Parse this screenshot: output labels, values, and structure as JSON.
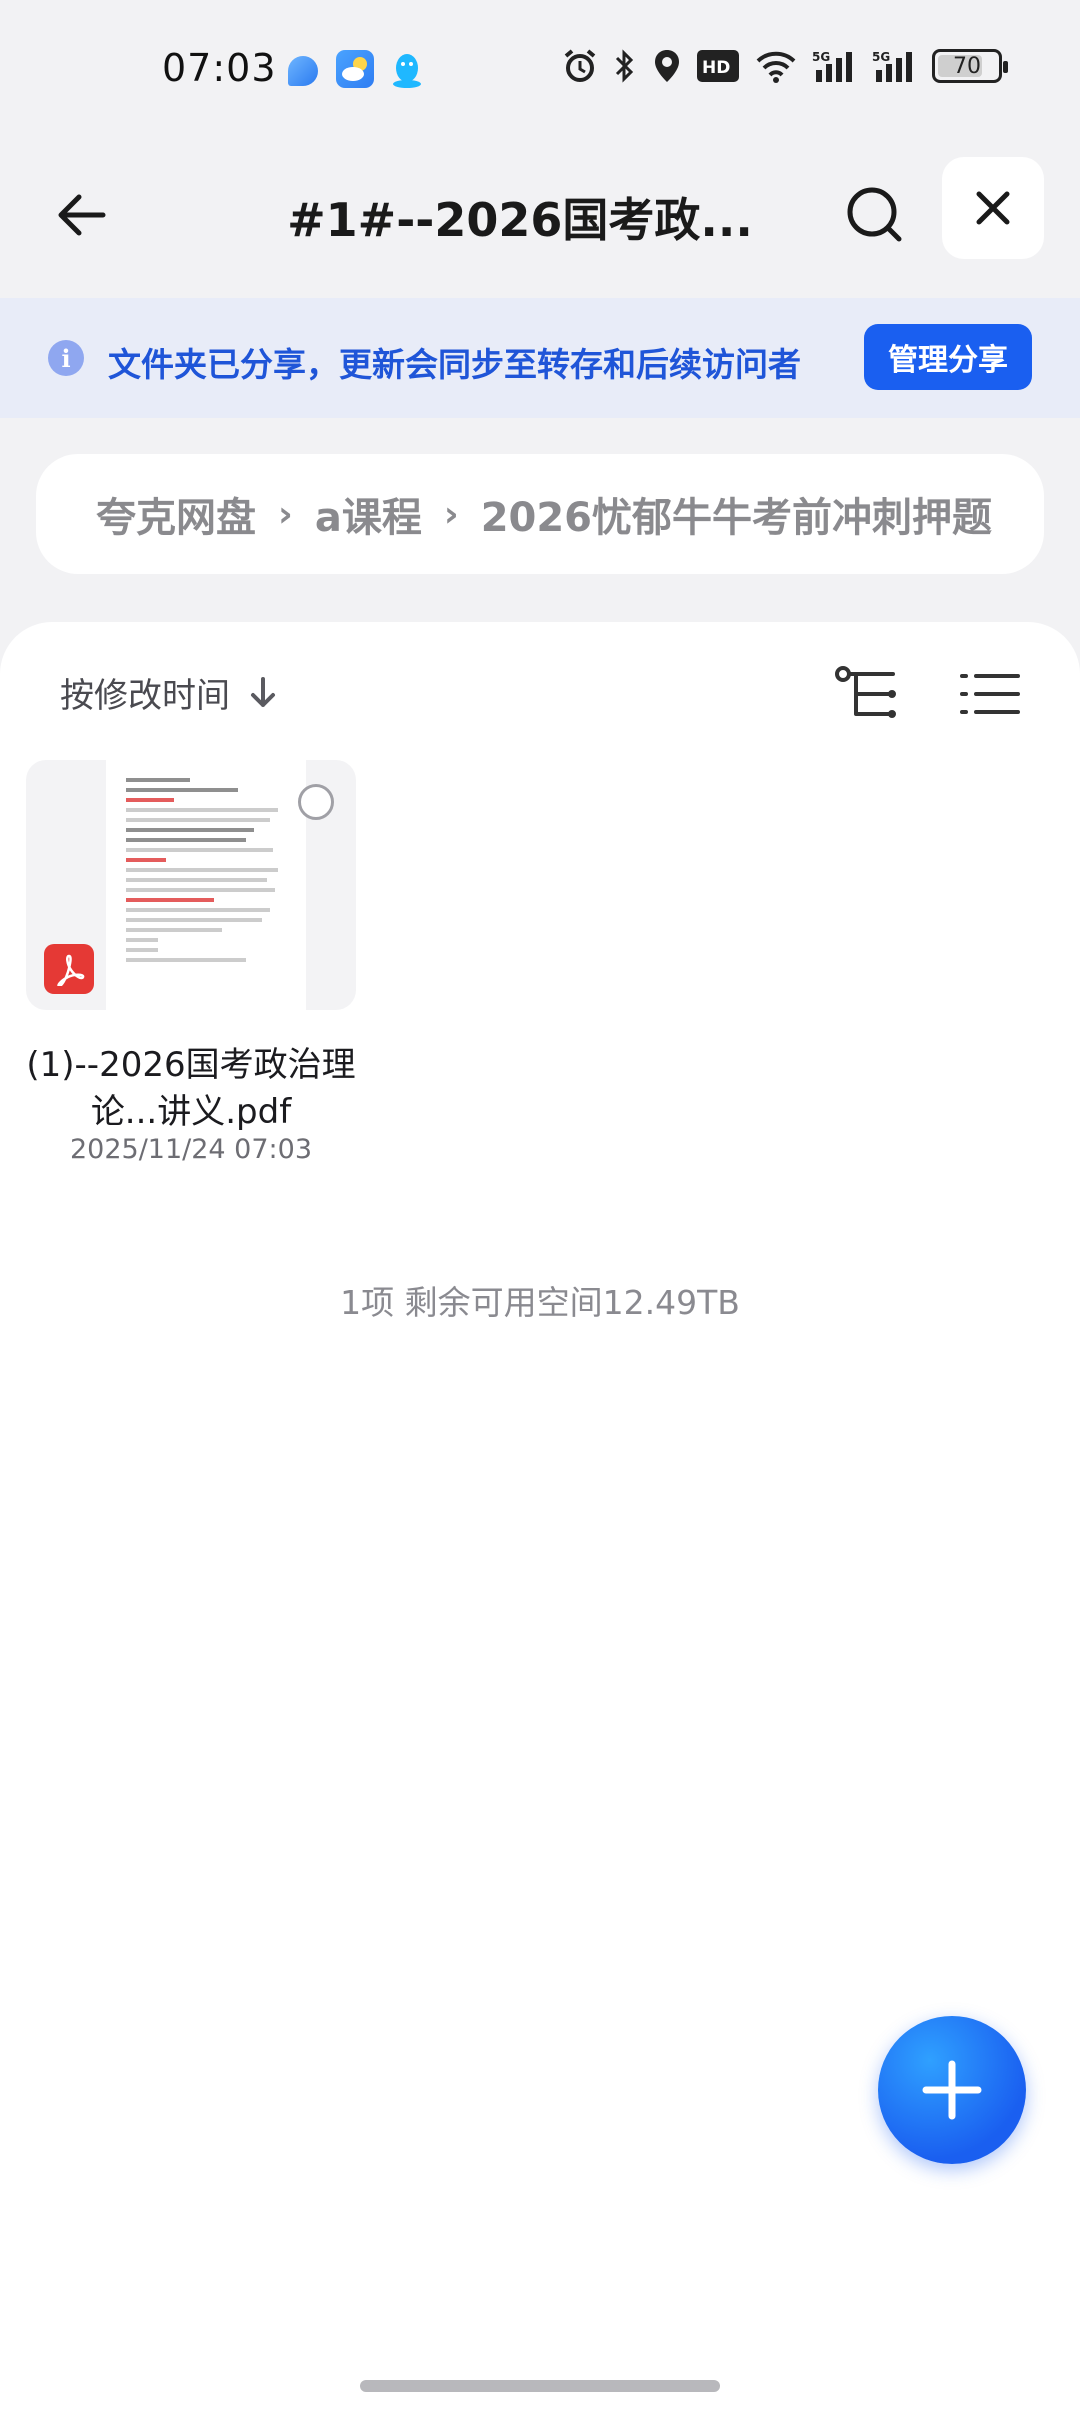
{
  "status_bar": {
    "time": "07:03",
    "battery": "70",
    "signal_labels": [
      "5G",
      "5G"
    ],
    "hd_label": "HD"
  },
  "header": {
    "title": "#1#--2026国考政...",
    "icons": [
      "back-arrow-icon",
      "search-icon",
      "close-icon"
    ]
  },
  "banner": {
    "text": "文件夹已分享，更新会同步至转存和后续访问者",
    "button": "管理分享",
    "accent": "#1a5ff0"
  },
  "breadcrumb": {
    "items": [
      "夸克网盘",
      "a课程",
      "2026忧郁牛牛考前冲刺押题"
    ]
  },
  "toolbar": {
    "sort_label": "按修改时间"
  },
  "files": [
    {
      "name": "(1)--2026国考政治理论...讲义.pdf",
      "date": "2025/11/24 07:03",
      "type": "pdf"
    }
  ],
  "footer": {
    "summary": "1项 剩余可用空间12.49TB"
  }
}
